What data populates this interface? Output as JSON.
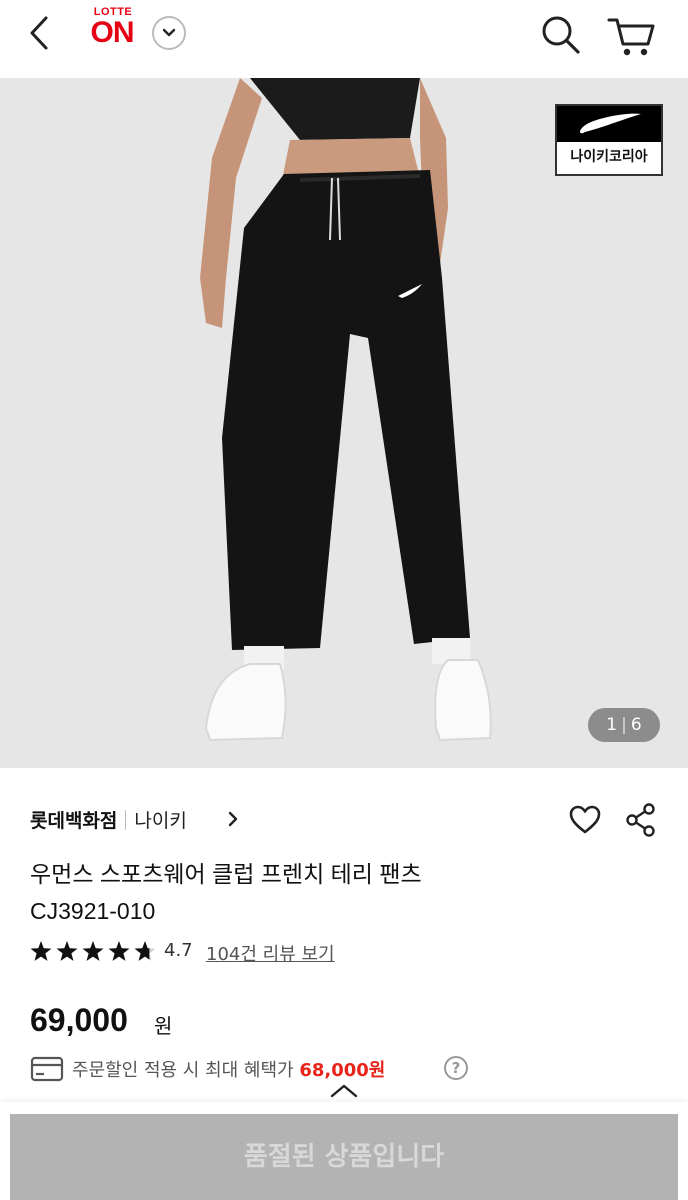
{
  "header": {
    "logo_top": "LOTTE",
    "logo_main": "ON"
  },
  "hero": {
    "brand_badge_label": "나이키코리아",
    "counter_current": "1",
    "counter_total": "6"
  },
  "product": {
    "store_name": "롯데백화점",
    "brand": "나이키",
    "title_line1": "우먼스 스포츠웨어 클럽 프렌치 테리 팬츠",
    "title_line2": "CJ3921-010",
    "rating": "4.7",
    "rating_stars": 4.7,
    "review_link": "104건 리뷰 보기",
    "price": "69,000",
    "price_unit": "원",
    "benefit_text": "주문할인 적용 시 최대 혜택가 ",
    "benefit_amount": "68,000원",
    "help_icon": "?"
  },
  "bottom": {
    "soldout_label": "품절된 상품입니다"
  },
  "colors": {
    "accent": "#e60012",
    "benefit": "#e8231a",
    "soldout_bg": "#b3b3b3",
    "hero_bg": "#e6e6e6"
  },
  "icons": [
    "back-icon",
    "chevron-down-icon",
    "search-icon",
    "cart-icon",
    "swoosh-icon",
    "chevron-right-icon",
    "heart-icon",
    "share-icon",
    "star-icon",
    "card-icon",
    "help-icon",
    "chevron-up-icon"
  ]
}
